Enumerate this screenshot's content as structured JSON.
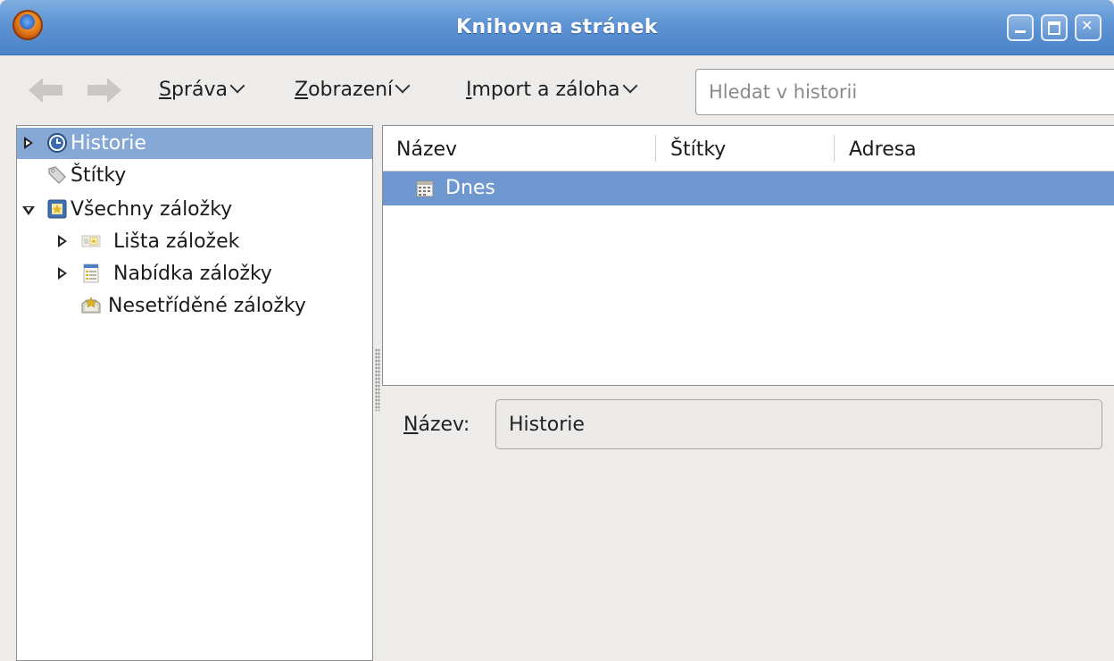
{
  "window": {
    "title": "Knihovna stránek"
  },
  "toolbar": {
    "back": "back",
    "forward": "forward",
    "menus": [
      {
        "label": "Správa",
        "mnemonic": "S",
        "rest": "práva"
      },
      {
        "label": "Zobrazení",
        "mnemonic": "Z",
        "rest": "obrazení"
      },
      {
        "label": "Import a záloha",
        "mnemonic": "I",
        "rest": "mport a záloha"
      }
    ],
    "search_placeholder": "Hledat v historii",
    "search_value": ""
  },
  "tree": {
    "items": [
      {
        "label": "Historie",
        "icon": "clock-icon",
        "expander": "collapsed",
        "selected": true
      },
      {
        "label": "Štítky",
        "icon": "tag-icon",
        "expander": "none",
        "selected": false
      },
      {
        "label": "Všechny záložky",
        "icon": "bookmarks-folder-icon",
        "expander": "expanded",
        "selected": false
      },
      {
        "label": "Lišta záložek",
        "icon": "toolbar-folder-icon",
        "expander": "collapsed",
        "selected": false
      },
      {
        "label": "Nabídka záložky",
        "icon": "menu-folder-icon",
        "expander": "collapsed",
        "selected": false
      },
      {
        "label": "Nesetříděné záložky",
        "icon": "unsorted-folder-icon",
        "expander": "none",
        "selected": false
      }
    ]
  },
  "list": {
    "columns": [
      "Název",
      "Štítky",
      "Adresa"
    ],
    "rows": [
      {
        "name": "Dnes",
        "icon": "calendar-icon",
        "tags": "",
        "address": "",
        "selected": true
      }
    ]
  },
  "details": {
    "name_label": "Název:",
    "name_mnemonic": "N",
    "name_rest": "ázev:",
    "name_value": "Historie"
  },
  "colors": {
    "titlebar": "#5d93d4",
    "selection": "#6e98cf",
    "tree_selection": "#86a8d6",
    "window_bg": "#edeceb"
  }
}
